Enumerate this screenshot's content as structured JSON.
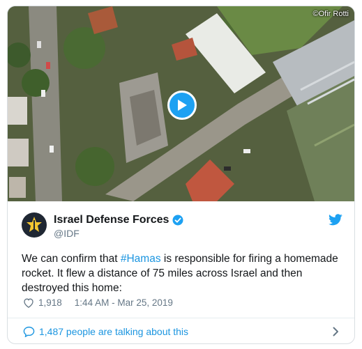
{
  "media": {
    "credit": "©Ofir Rotti",
    "play_icon": "play-icon"
  },
  "author": {
    "name": "Israel Defense Forces",
    "handle": "@IDF",
    "verified_icon": "verified-badge-icon",
    "avatar_icon": "idf-emblem-icon"
  },
  "tweet": {
    "text_before": "We can confirm that ",
    "hashtag": "#Hamas",
    "text_after": " is responsible for firing a homemade rocket. It flew a distance of 75 miles across Israel and then destroyed this home:",
    "likes": "1,918",
    "timestamp": "1:44 AM - Mar 25, 2019"
  },
  "footer": {
    "talking": "1,487 people are talking about this"
  },
  "colors": {
    "accent": "#1da1f2",
    "link": "#1b95e0",
    "muted": "#657786"
  }
}
